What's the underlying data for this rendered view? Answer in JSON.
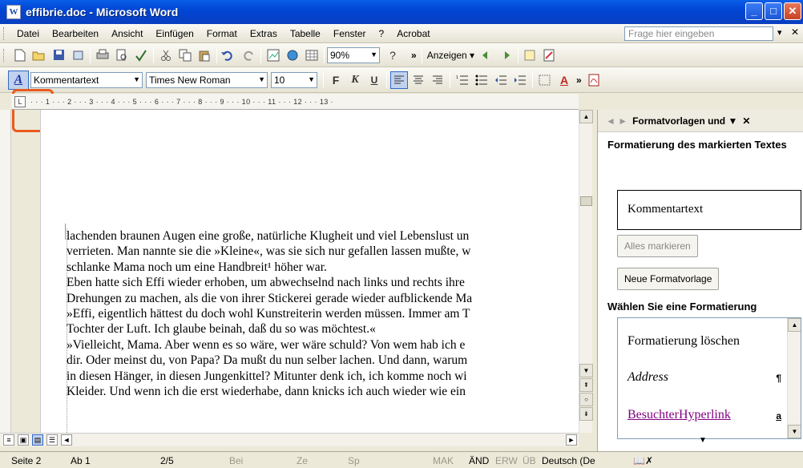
{
  "title": {
    "text": "effibrie.doc - Microsoft Word",
    "app_icon": "W"
  },
  "window": {
    "minimize": "_",
    "maximize": "□",
    "close": "✕"
  },
  "menu": [
    "Datei",
    "Bearbeiten",
    "Ansicht",
    "Einfügen",
    "Format",
    "Extras",
    "Tabelle",
    "Fenster",
    "?",
    "Acrobat"
  ],
  "ask": {
    "placeholder": "Frage hier eingeben",
    "arrow": "▾",
    "close": "✕"
  },
  "toolbar1": {
    "zoom": "90%",
    "help": "?",
    "more": "»",
    "show_label": "Anzeigen ▾"
  },
  "toolbar2": {
    "style_icon": "A",
    "style": "Kommentartext",
    "font": "Times New Roman",
    "size": "10",
    "bold": "F",
    "italic": "K",
    "underline": "U",
    "more": "»"
  },
  "ruler": "· · · 1 · · · 2 · · · 3 · · · 4 · · · 5 · · · 6 · · · 7 · · · 8 · · · 9 · · · 10 · · · 11 · · · 12 · · · 13 ·",
  "ruler_tab": "L",
  "document": {
    "lines": [
      "lachenden braunen Augen eine große, natürliche Klugheit und viel Lebenslust un",
      "verrieten. Man nannte sie die »Kleine«, was sie sich nur gefallen lassen mußte, w",
      "schlanke Mama noch um eine Handbreit¹ höher war.",
      "Eben hatte sich Effi wieder erhoben, um abwechselnd nach links und rechts ihre",
      "Drehungen zu machen, als die von ihrer Stickerei gerade wieder aufblickende Ma",
      "»Effi, eigentlich hättest du doch wohl Kunstreiterin werden müssen. Immer am T",
      "Tochter der Luft. Ich glaube beinah, daß du so was möchtest.«",
      "»Vielleicht, Mama. Aber wenn es so wäre, wer wäre schuld? Von wem hab ich e",
      "dir. Oder meinst du, von Papa? Da mußt du nun selber lachen. Und dann, warum",
      "in diesen Hänger, in diesen Jungenkittel? Mitunter denk ich, ich komme noch wi",
      "Kleider. Und wenn ich die erst wiederhabe, dann knicks ich auch wieder wie ein"
    ]
  },
  "status": {
    "page": "Seite 2",
    "section": "Ab 1",
    "pages": "2/5",
    "at": "Bei",
    "line": "Ze",
    "col": "Sp",
    "mak": "MAK",
    "and": "ÄND",
    "erw": "ERW",
    "ub": "ÜB",
    "lang": "Deutsch (De",
    "spell": "📖✗"
  },
  "taskpane": {
    "header": "Formatvorlagen und ▼",
    "close": "✕",
    "nav": "◄ ►",
    "section1": "Formatierung des markierten Textes",
    "current_style": "Kommentartext",
    "select_all": "Alles markieren",
    "new_style": "Neue Formatvorlage",
    "section2": "Wählen Sie eine Formatierung",
    "styles": [
      {
        "name": "Formatierung löschen",
        "mark": ""
      },
      {
        "name": "Address",
        "mark": "¶"
      },
      {
        "name": "BesuchterHyperlink",
        "mark": "a"
      }
    ],
    "down": "▼"
  },
  "colors": {
    "highlight": "#ea5a1e",
    "visited_link": "#800080",
    "title_bar": "#0046d5"
  }
}
